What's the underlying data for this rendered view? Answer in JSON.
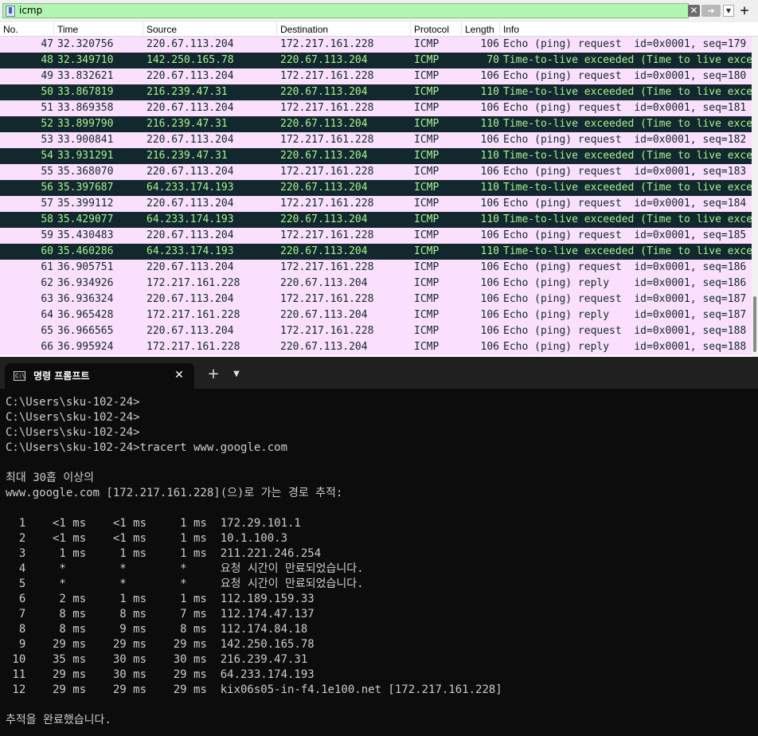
{
  "wireshark": {
    "filter": {
      "value": "icmp"
    },
    "icons": {
      "bookmark": "bookmark-icon",
      "clear": "clear-icon",
      "apply": "arrow-right-icon",
      "recent": "chevron-down-icon",
      "add": "plus-icon"
    },
    "columns": [
      "No.",
      "Time",
      "Source",
      "Destination",
      "Protocol",
      "Length",
      "Info"
    ],
    "colors": {
      "request_bg": "#fae0fc",
      "request_fg": "#12272e",
      "ttl_bg": "#12272e",
      "ttl_fg": "#a8f28f"
    },
    "packets": [
      {
        "no": "47",
        "time": "32.320756",
        "src": "220.67.113.204",
        "dst": "172.217.161.228",
        "proto": "ICMP",
        "len": "106",
        "info": "Echo (ping) request  id=0x0001, seq=179",
        "kind": "req"
      },
      {
        "no": "48",
        "time": "32.349710",
        "src": "142.250.165.78",
        "dst": "220.67.113.204",
        "proto": "ICMP",
        "len": "70",
        "info": "Time-to-live exceeded (Time to live exceeded",
        "kind": "ttl"
      },
      {
        "no": "49",
        "time": "33.832621",
        "src": "220.67.113.204",
        "dst": "172.217.161.228",
        "proto": "ICMP",
        "len": "106",
        "info": "Echo (ping) request  id=0x0001, seq=180",
        "kind": "req"
      },
      {
        "no": "50",
        "time": "33.867819",
        "src": "216.239.47.31",
        "dst": "220.67.113.204",
        "proto": "ICMP",
        "len": "110",
        "info": "Time-to-live exceeded (Time to live exceeded",
        "kind": "ttl"
      },
      {
        "no": "51",
        "time": "33.869358",
        "src": "220.67.113.204",
        "dst": "172.217.161.228",
        "proto": "ICMP",
        "len": "106",
        "info": "Echo (ping) request  id=0x0001, seq=181",
        "kind": "req"
      },
      {
        "no": "52",
        "time": "33.899790",
        "src": "216.239.47.31",
        "dst": "220.67.113.204",
        "proto": "ICMP",
        "len": "110",
        "info": "Time-to-live exceeded (Time to live exceeded",
        "kind": "ttl"
      },
      {
        "no": "53",
        "time": "33.900841",
        "src": "220.67.113.204",
        "dst": "172.217.161.228",
        "proto": "ICMP",
        "len": "106",
        "info": "Echo (ping) request  id=0x0001, seq=182",
        "kind": "req"
      },
      {
        "no": "54",
        "time": "33.931291",
        "src": "216.239.47.31",
        "dst": "220.67.113.204",
        "proto": "ICMP",
        "len": "110",
        "info": "Time-to-live exceeded (Time to live exceeded",
        "kind": "ttl"
      },
      {
        "no": "55",
        "time": "35.368070",
        "src": "220.67.113.204",
        "dst": "172.217.161.228",
        "proto": "ICMP",
        "len": "106",
        "info": "Echo (ping) request  id=0x0001, seq=183",
        "kind": "req"
      },
      {
        "no": "56",
        "time": "35.397687",
        "src": "64.233.174.193",
        "dst": "220.67.113.204",
        "proto": "ICMP",
        "len": "110",
        "info": "Time-to-live exceeded (Time to live exceeded",
        "kind": "ttl"
      },
      {
        "no": "57",
        "time": "35.399112",
        "src": "220.67.113.204",
        "dst": "172.217.161.228",
        "proto": "ICMP",
        "len": "106",
        "info": "Echo (ping) request  id=0x0001, seq=184",
        "kind": "req"
      },
      {
        "no": "58",
        "time": "35.429077",
        "src": "64.233.174.193",
        "dst": "220.67.113.204",
        "proto": "ICMP",
        "len": "110",
        "info": "Time-to-live exceeded (Time to live exceeded",
        "kind": "ttl"
      },
      {
        "no": "59",
        "time": "35.430483",
        "src": "220.67.113.204",
        "dst": "172.217.161.228",
        "proto": "ICMP",
        "len": "106",
        "info": "Echo (ping) request  id=0x0001, seq=185",
        "kind": "req"
      },
      {
        "no": "60",
        "time": "35.460286",
        "src": "64.233.174.193",
        "dst": "220.67.113.204",
        "proto": "ICMP",
        "len": "110",
        "info": "Time-to-live exceeded (Time to live exceeded",
        "kind": "ttl"
      },
      {
        "no": "61",
        "time": "36.905751",
        "src": "220.67.113.204",
        "dst": "172.217.161.228",
        "proto": "ICMP",
        "len": "106",
        "info": "Echo (ping) request  id=0x0001, seq=186",
        "kind": "req"
      },
      {
        "no": "62",
        "time": "36.934926",
        "src": "172.217.161.228",
        "dst": "220.67.113.204",
        "proto": "ICMP",
        "len": "106",
        "info": "Echo (ping) reply    id=0x0001, seq=186",
        "kind": "req"
      },
      {
        "no": "63",
        "time": "36.936324",
        "src": "220.67.113.204",
        "dst": "172.217.161.228",
        "proto": "ICMP",
        "len": "106",
        "info": "Echo (ping) request  id=0x0001, seq=187",
        "kind": "req"
      },
      {
        "no": "64",
        "time": "36.965428",
        "src": "172.217.161.228",
        "dst": "220.67.113.204",
        "proto": "ICMP",
        "len": "106",
        "info": "Echo (ping) reply    id=0x0001, seq=187",
        "kind": "req"
      },
      {
        "no": "65",
        "time": "36.966565",
        "src": "220.67.113.204",
        "dst": "172.217.161.228",
        "proto": "ICMP",
        "len": "106",
        "info": "Echo (ping) request  id=0x0001, seq=188",
        "kind": "req"
      },
      {
        "no": "66",
        "time": "36.995924",
        "src": "172.217.161.228",
        "dst": "220.67.113.204",
        "proto": "ICMP",
        "len": "106",
        "info": "Echo (ping) reply    id=0x0001, seq=188",
        "kind": "req"
      }
    ]
  },
  "terminal": {
    "tab": {
      "title": "명령 프롬프트",
      "icon": "cmd-icon",
      "close": "✕",
      "new_tab": "+",
      "dropdown": "⌄"
    },
    "lines": [
      "C:\\Users\\sku-102-24>",
      "C:\\Users\\sku-102-24>",
      "C:\\Users\\sku-102-24>",
      "C:\\Users\\sku-102-24>tracert www.google.com",
      "",
      "최대 30홉 이상의",
      "www.google.com [172.217.161.228](으)로 가는 경로 추적:",
      "",
      "  1    <1 ms    <1 ms     1 ms  172.29.101.1",
      "  2    <1 ms    <1 ms     1 ms  10.1.100.3",
      "  3     1 ms     1 ms     1 ms  211.221.246.254",
      "  4     *        *        *     요청 시간이 만료되었습니다.",
      "  5     *        *        *     요청 시간이 만료되었습니다.",
      "  6     2 ms     1 ms     1 ms  112.189.159.33",
      "  7     8 ms     8 ms     7 ms  112.174.47.137",
      "  8     8 ms     9 ms     8 ms  112.174.84.18",
      "  9    29 ms    29 ms    29 ms  142.250.165.78",
      " 10    35 ms    30 ms    30 ms  216.239.47.31",
      " 11    29 ms    30 ms    29 ms  64.233.174.193",
      " 12    29 ms    29 ms    29 ms  kix06s05-in-f4.1e100.net [172.217.161.228]",
      "",
      "추적을 완료했습니다."
    ]
  }
}
